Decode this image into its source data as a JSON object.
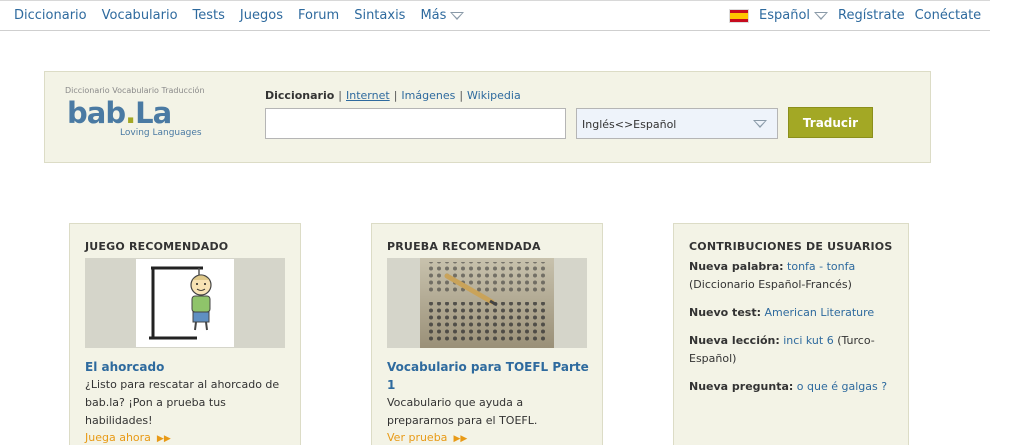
{
  "nav": {
    "items": [
      "Diccionario",
      "Vocabulario",
      "Tests",
      "Juegos",
      "Forum",
      "Sintaxis",
      "Más"
    ],
    "language": "Español",
    "register": "Regístrate",
    "login": "Conéctate"
  },
  "logo": {
    "tagline": "Diccionario Vocabulario Traducción",
    "word_a": "bab",
    "word_dot": ".",
    "word_b": "La",
    "sub": "Loving  Languages"
  },
  "search": {
    "tabs": [
      "Diccionario",
      "Internet",
      "Imágenes",
      "Wikipedia"
    ],
    "input_value": "",
    "language_pair": "Inglés<>Español",
    "button": "Traducir"
  },
  "cards": {
    "game": {
      "title": "JUEGO RECOMENDADO",
      "heading": "El ahorcado",
      "desc": "¿Listo para rescatar al ahorcado de bab.la? ¡Pon a prueba tus habilidades!",
      "more": "Juega ahora"
    },
    "test": {
      "title": "PRUEBA RECOMENDADA",
      "heading": "Vocabulario para TOEFL Parte 1",
      "desc": "Vocabulario que ayuda a prepararnos para el TOEFL.",
      "more": "Ver prueba"
    },
    "contrib": {
      "title": "CONTRIBUCIONES DE USUARIOS",
      "word_label": "Nueva palabra:",
      "word_value": "tonfa - tonfa",
      "word_extra": "(Diccionario Español-Francés)",
      "test_label": "Nuevo test:",
      "test_value": "American Literature",
      "lesson_label": "Nueva lección:",
      "lesson_value": "inci kut 6",
      "lesson_extra": "(Turco-Español)",
      "question_label": "Nueva pregunta:",
      "question_value": "o que é galgas ?"
    }
  }
}
